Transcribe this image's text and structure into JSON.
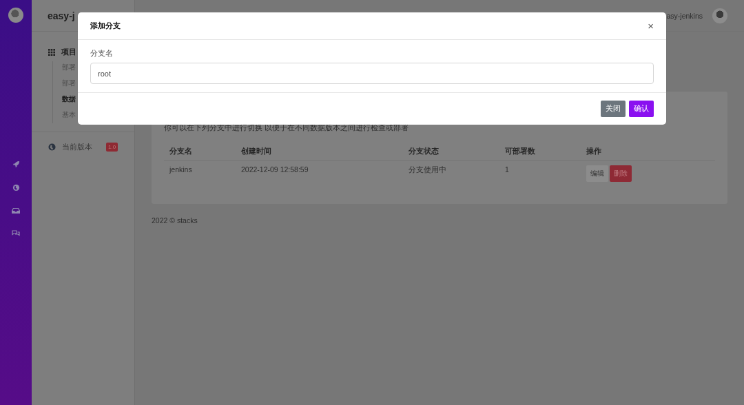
{
  "sidebar": {
    "brand": "easy-j",
    "section": {
      "title": "项目",
      "items": [
        {
          "label": "部署",
          "selected": false
        },
        {
          "label": "部署",
          "selected": false
        },
        {
          "label": "数据",
          "selected": true
        },
        {
          "label": "基本",
          "selected": false
        }
      ]
    },
    "version": {
      "label": "当前版本",
      "badge": "1.0"
    }
  },
  "header": {
    "user": "asy-jenkins"
  },
  "content": {
    "description": "你可以在下列分支中进行切换 以便于在不同数据版本之间进行检查或部署",
    "table": {
      "columns": [
        "分支名",
        "创建时间",
        "分支状态",
        "可部署数",
        "操作"
      ],
      "rows": [
        {
          "cells": [
            "jenkins",
            "2022-12-09 12:58:59",
            "分支使用中",
            "1"
          ],
          "actions": [
            {
              "label": "编辑",
              "kind": "secondary"
            },
            {
              "label": "删除",
              "kind": "danger"
            }
          ]
        }
      ]
    }
  },
  "footer": "2022 © stacks",
  "modal": {
    "title": "添加分支",
    "close": "×",
    "field": {
      "label": "分支名",
      "value": "root"
    },
    "buttons": [
      {
        "label": "关闭",
        "kind": "secondary"
      },
      {
        "label": "确认",
        "kind": "primary"
      }
    ]
  }
}
